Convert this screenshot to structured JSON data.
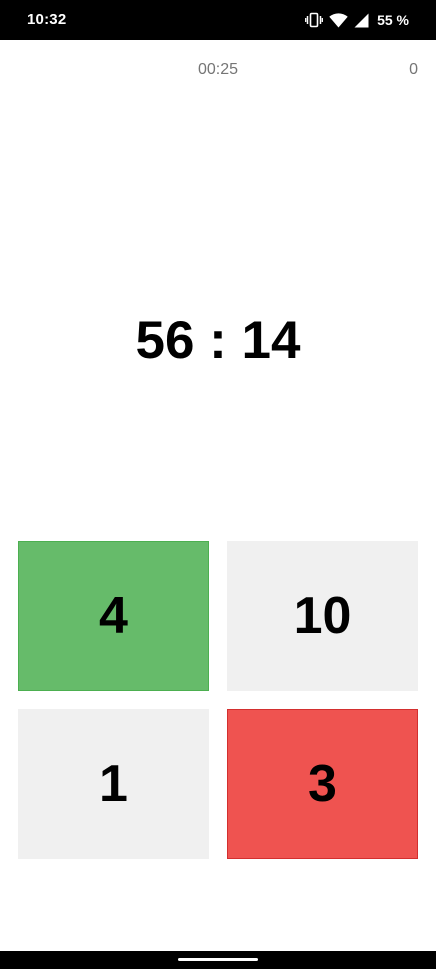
{
  "status_bar": {
    "time": "10:32",
    "battery_percent": "55 %",
    "icons": [
      "vibrate-icon",
      "wifi-icon",
      "signal-icon"
    ]
  },
  "game": {
    "timer": "00:25",
    "score": "0",
    "question": "56 : 14",
    "answers": [
      {
        "label": "4",
        "color": "#66bb6a",
        "state": "correct"
      },
      {
        "label": "10",
        "color": "#f0f0f0",
        "state": "neutral"
      },
      {
        "label": "1",
        "color": "#f0f0f0",
        "state": "neutral"
      },
      {
        "label": "3",
        "color": "#ef5350",
        "state": "wrong"
      }
    ]
  }
}
